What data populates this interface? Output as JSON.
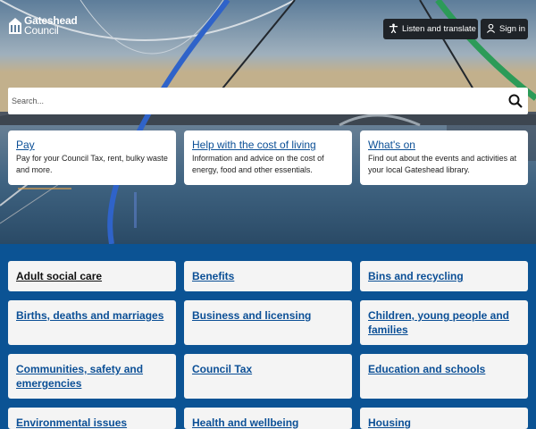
{
  "brand": {
    "line1": "Gateshead",
    "line2": "Council"
  },
  "header": {
    "listen_label": "Listen and translate",
    "signin_label": "Sign in"
  },
  "search": {
    "placeholder": "Search..."
  },
  "promos": [
    {
      "title": "Pay",
      "desc": "Pay for your Council Tax, rent, bulky waste and more."
    },
    {
      "title": "Help with the cost of living",
      "desc": "Information and advice on the cost of energy, food and other essentials."
    },
    {
      "title": "What's on",
      "desc": "Find out about the events and activities at your local Gateshead library."
    }
  ],
  "services": [
    "Adult social care",
    "Benefits",
    "Bins and recycling",
    "Births, deaths and marriages",
    "Business and licensing",
    "Children, young people and families",
    "Communities, safety and emergencies",
    "Council Tax",
    "Education and schools",
    "Environmental issues",
    "Health and wellbeing",
    "Housing"
  ],
  "colors": {
    "accent": "#0b5394",
    "link": "#0b4f96",
    "tile": "#f4f4f4",
    "button": "#1f2328"
  }
}
